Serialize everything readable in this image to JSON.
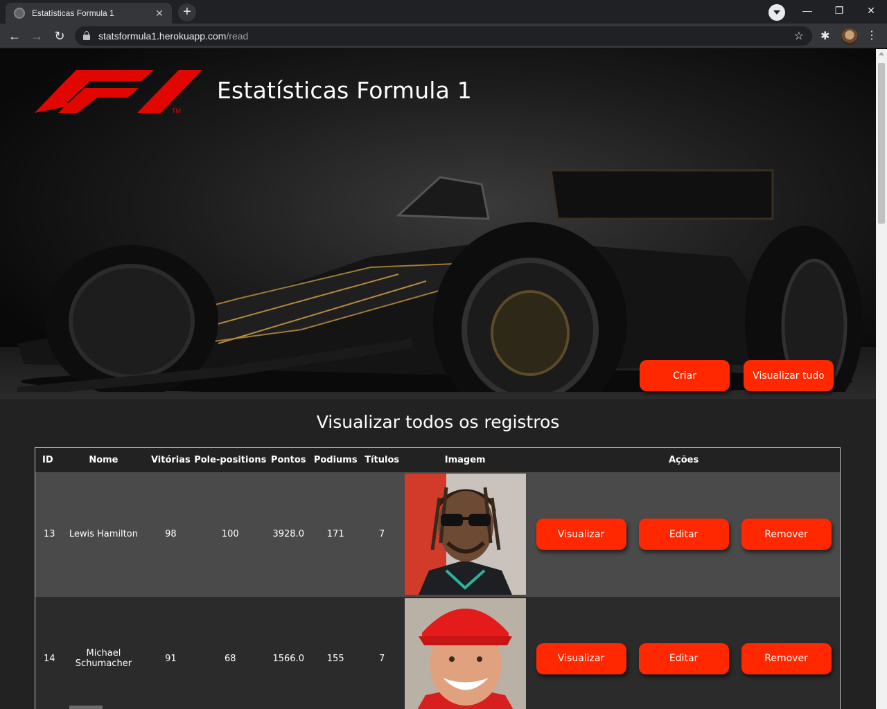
{
  "browser": {
    "tab_title": "Estatísticas Formula 1",
    "tab_close": "✕",
    "new_tab": "+",
    "url_host": "statsformula1.herokuapp.com",
    "url_path": "/read",
    "window_min": "—",
    "window_restore": "❐",
    "window_close": "✕",
    "back": "←",
    "forward": "→",
    "reload": "↻",
    "star": "☆",
    "extensions": "✱",
    "menu": "⋮"
  },
  "header": {
    "title": "Estatísticas Formula 1",
    "logo_tm": "TM",
    "buttons": {
      "create": "Criar",
      "view_all": "Visualizar tudo"
    }
  },
  "main": {
    "section_title": "Visualizar todos os registros",
    "columns": [
      "ID",
      "Nome",
      "Vitórias",
      "Pole-positions",
      "Pontos",
      "Podiums",
      "Títulos",
      "Imagem",
      "Ações"
    ],
    "rows": [
      {
        "id": "13",
        "name": "Lewis Hamilton",
        "wins": "98",
        "poles": "100",
        "points": "3928.0",
        "podiums": "171",
        "titles": "7"
      },
      {
        "id": "14",
        "name": "Michael Schumacher",
        "wins": "91",
        "poles": "68",
        "points": "1566.0",
        "podiums": "155",
        "titles": "7"
      }
    ],
    "actions": {
      "view": "Visualizar",
      "edit": "Editar",
      "remove": "Remover"
    }
  },
  "colors": {
    "accent": "#ff2800",
    "background": "#222222",
    "row_highlight": "#4a4a4a"
  },
  "icons": [
    "globe-icon",
    "close-icon",
    "plus-icon",
    "tab-search-icon",
    "back-icon",
    "forward-icon",
    "reload-icon",
    "lock-icon",
    "star-icon",
    "puzzle-icon",
    "avatar",
    "menu-icon",
    "f1-logo"
  ]
}
